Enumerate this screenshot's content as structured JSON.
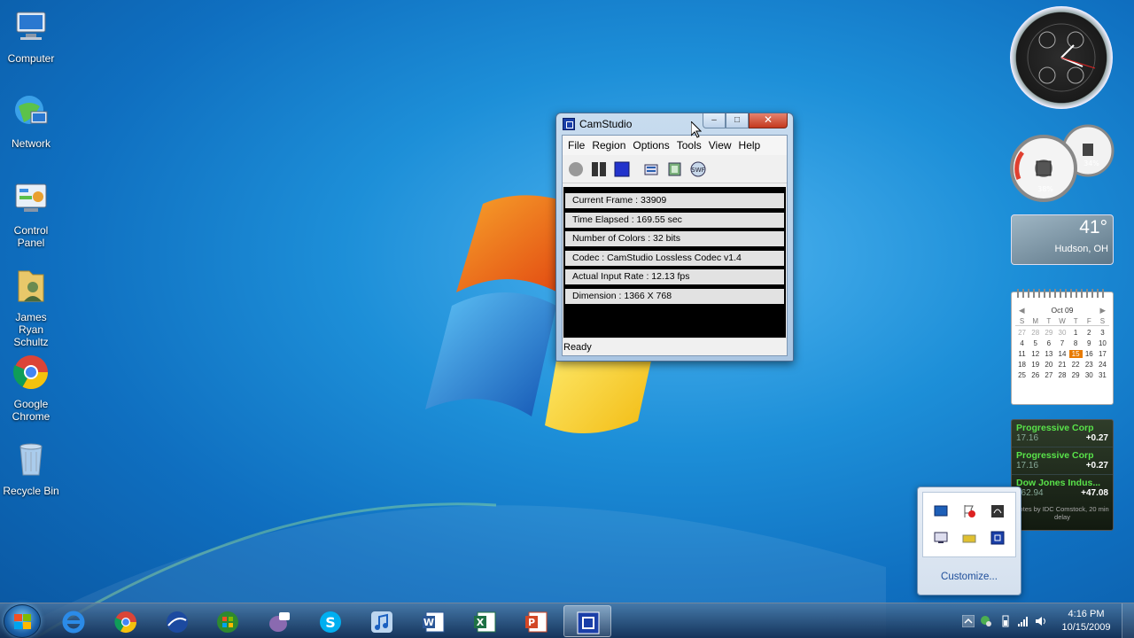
{
  "desktop": {
    "icons": [
      {
        "label": "Computer",
        "icon": "computer-icon"
      },
      {
        "label": "Network",
        "icon": "network-icon"
      },
      {
        "label": "Control Panel",
        "icon": "control-panel-icon"
      },
      {
        "label": "James Ryan Schultz",
        "icon": "user-folder-icon"
      },
      {
        "label": "Google Chrome",
        "icon": "chrome-icon"
      },
      {
        "label": "Recycle Bin",
        "icon": "recycle-bin-icon"
      }
    ]
  },
  "camstudio": {
    "title": "CamStudio",
    "controls": {
      "minimize": "–",
      "maximize": "□",
      "close": "✕"
    },
    "menu": [
      "File",
      "Region",
      "Options",
      "Tools",
      "View",
      "Help"
    ],
    "toolbar": [
      {
        "name": "record-button",
        "icon": "record-icon"
      },
      {
        "name": "pause-button",
        "icon": "pause-icon"
      },
      {
        "name": "stop-button",
        "icon": "stop-icon"
      },
      {
        "name": "annotation-button",
        "icon": "annotation-icon"
      },
      {
        "name": "video-options-button",
        "icon": "video-options-icon"
      },
      {
        "name": "swf-button",
        "icon": "swf-icon",
        "label": "SWF"
      }
    ],
    "stats": [
      "Current Frame : 33909",
      "Time Elapsed  : 169.55 sec",
      "Number of Colors  : 32 bits",
      "Codec  : CamStudio Lossless Codec v1.4",
      "Actual Input Rate  : 12.13 fps",
      "Dimension  : 1366 X 768"
    ],
    "status": "Ready"
  },
  "gadgets": {
    "meter": {
      "cpu": "38%",
      "memory": "34%"
    },
    "weather": {
      "temperature": "41°",
      "location": "Hudson, OH"
    },
    "calendar": {
      "month": "Oct 09",
      "weekdays": [
        "S",
        "M",
        "T",
        "W",
        "T",
        "F",
        "S"
      ],
      "days": [
        [
          "27",
          "28",
          "29",
          "30",
          "1",
          "2",
          "3"
        ],
        [
          "4",
          "5",
          "6",
          "7",
          "8",
          "9",
          "10"
        ],
        [
          "11",
          "12",
          "13",
          "14",
          "15",
          "16",
          "17"
        ],
        [
          "18",
          "19",
          "20",
          "21",
          "22",
          "23",
          "24"
        ],
        [
          "25",
          "26",
          "27",
          "28",
          "29",
          "30",
          "31"
        ]
      ],
      "today": "15"
    },
    "stocks": {
      "items": [
        {
          "name": "Progressive Corp",
          "price": "17.16",
          "change": "+0.27"
        },
        {
          "name": "Progressive Corp",
          "price": "17.16",
          "change": "+0.27"
        },
        {
          "name": "Dow Jones Indus...",
          "price": "062.94",
          "change": "+47.08"
        }
      ],
      "note": "uotes by IDC Comstock, 20 min delay"
    }
  },
  "tray_popup": {
    "customize_label": "Customize..."
  },
  "taskbar": {
    "pinned": [
      {
        "name": "internet-explorer",
        "icon": "ie-icon"
      },
      {
        "name": "google-chrome",
        "icon": "chrome-icon"
      },
      {
        "name": "google-earth",
        "icon": "google-earth-icon"
      },
      {
        "name": "windows-media-center",
        "icon": "windows-icon"
      },
      {
        "name": "pidgin",
        "icon": "pidgin-icon"
      },
      {
        "name": "skype",
        "icon": "skype-icon"
      },
      {
        "name": "itunes",
        "icon": "itunes-icon"
      },
      {
        "name": "word",
        "icon": "word-icon"
      },
      {
        "name": "excel",
        "icon": "excel-icon"
      },
      {
        "name": "powerpoint",
        "icon": "powerpoint-icon"
      },
      {
        "name": "camstudio",
        "icon": "camstudio-icon",
        "active": true
      }
    ],
    "time": "4:16 PM",
    "date": "10/15/2009"
  }
}
